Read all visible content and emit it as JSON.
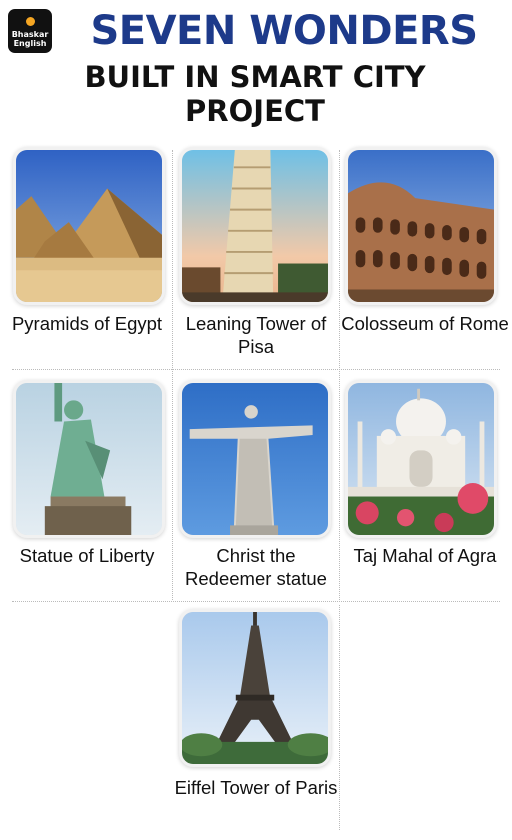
{
  "brand": {
    "line1": "Bhaskar",
    "line2": "English"
  },
  "header": {
    "title": "SEVEN WONDERS",
    "subtitle": "BUILT IN SMART CITY PROJECT"
  },
  "wonders": [
    {
      "icon": "pyramids-photo",
      "label": "Pyramids of Egypt"
    },
    {
      "icon": "pisa-tower-photo",
      "label": "Leaning Tower of Pisa"
    },
    {
      "icon": "colosseum-photo",
      "label": "Colosseum of Rome"
    },
    {
      "icon": "statue-of-liberty-photo",
      "label": "Statue of Liberty"
    },
    {
      "icon": "christ-redeemer-photo",
      "label": "Christ the Redeemer statue"
    },
    {
      "icon": "taj-mahal-photo",
      "label": "Taj Mahal of Agra"
    },
    {
      "icon": "eiffel-tower-photo",
      "label": "Eiffel Tower of Paris"
    }
  ]
}
